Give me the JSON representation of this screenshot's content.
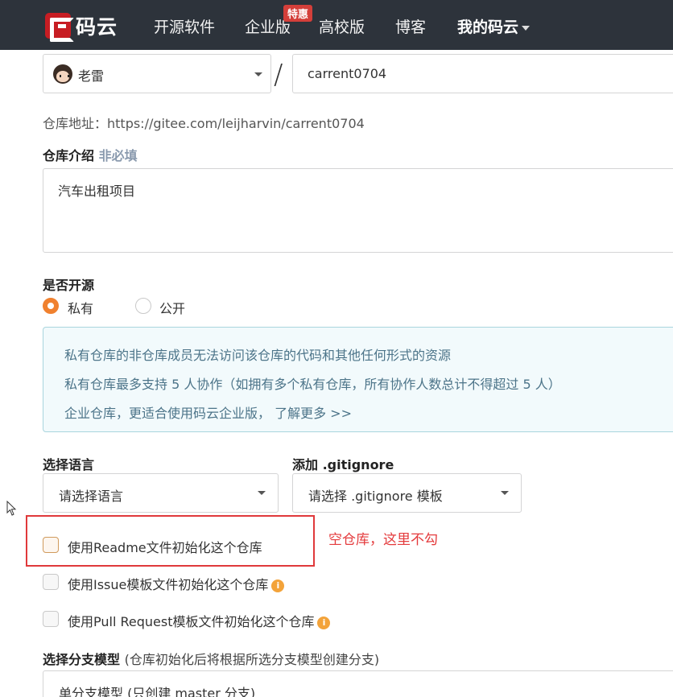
{
  "header": {
    "logo_text": "码云",
    "nav": [
      "开源软件",
      "企业版",
      "高校版",
      "博客",
      "我的码云"
    ],
    "badge": "特惠"
  },
  "form": {
    "owner": "老雷",
    "slash": "/",
    "repo_name": "carrent0704",
    "repo_url": "仓库地址：https://gitee.com/leijharvin/carrent0704",
    "desc_title": "仓库介绍",
    "desc_optional": "非必填",
    "desc_value": "汽车出租项目",
    "open_title": "是否开源",
    "private_label": "私有",
    "public_label": "公开",
    "info_lines": [
      "私有仓库的非仓库成员无法访问该仓库的代码和其他任何形式的资源",
      "私有仓库最多支持 5 人协作（如拥有多个私有仓库，所有协作人数总计不得超过 5 人）",
      "企业仓库，更适合使用码云企业版， 了解更多 >>"
    ],
    "lang_title": "选择语言",
    "lang_value": "请选择语言",
    "gitignore_title": "添加 .gitignore",
    "gitignore_value": "请选择 .gitignore 模板",
    "readme_label": "使用Readme文件初始化这个仓库",
    "issue_label": "使用Issue模板文件初始化这个仓库",
    "pr_label": "使用Pull Request模板文件初始化这个仓库",
    "branch_title": "选择分支模型",
    "branch_hint": "(仓库初始化后将根据所选分支模型创建分支)",
    "branch_value": "单分支模型 (只创建 master 分支)"
  },
  "annotation": "空仓库，这里不勾",
  "colors": {
    "header_bg": "#2d333b",
    "brand": "#c71d23",
    "accent": "#f0812f",
    "annotation": "#e43b3d"
  }
}
